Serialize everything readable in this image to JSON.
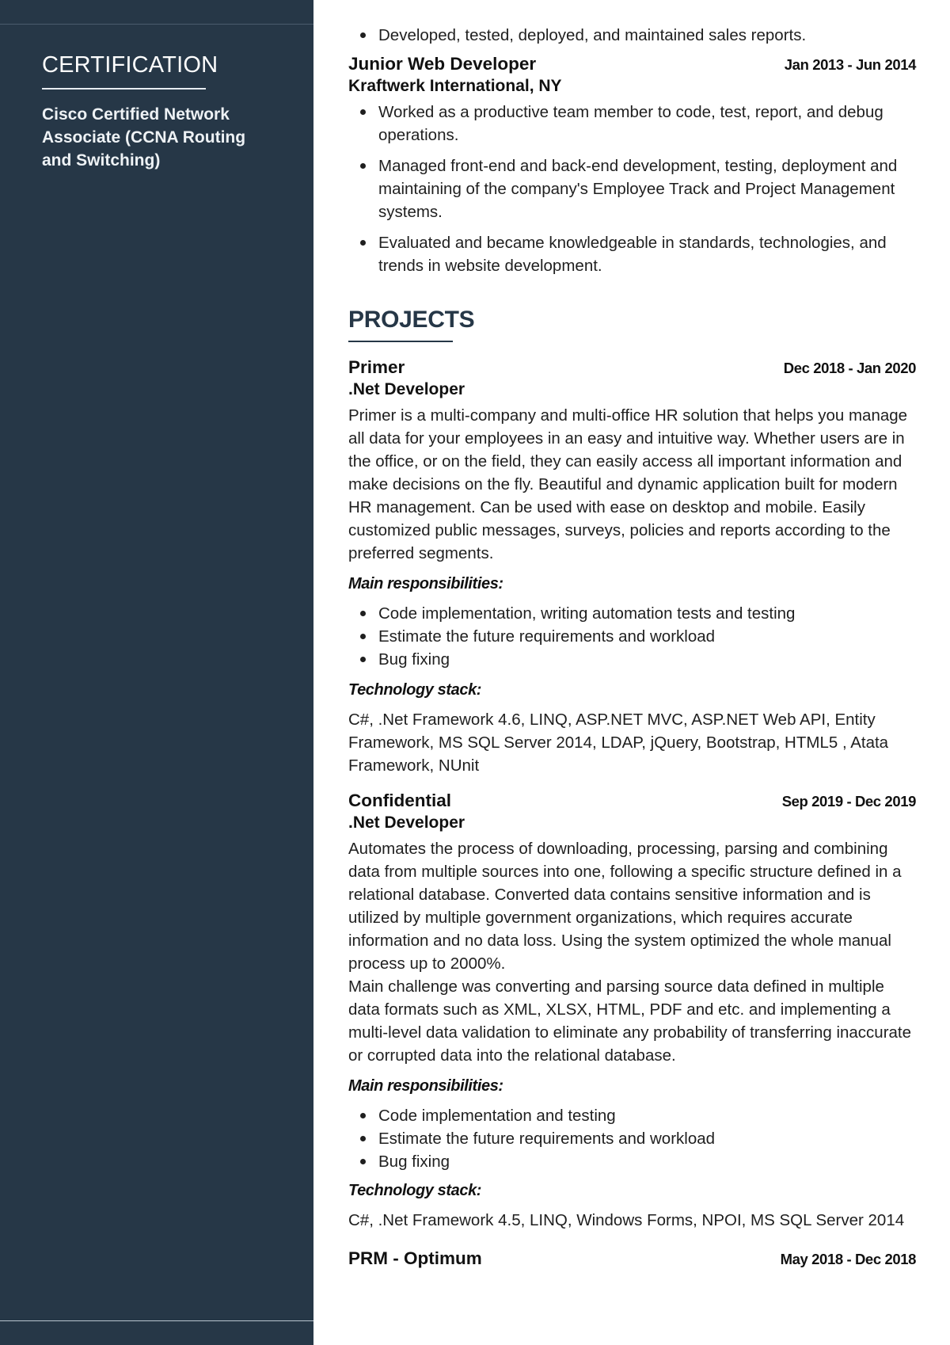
{
  "sidebar": {
    "certification_title": "CERTIFICATION",
    "certification_item": "Cisco Certified Network Associate (CCNA Routing and Switching)",
    "colors": {
      "background": "#263747",
      "text": "#ffffff"
    }
  },
  "experience_tail": {
    "previous_bullets": [
      "Developed, tested, deployed, and maintained sales reports."
    ],
    "jobs": [
      {
        "title": "Junior Web Developer",
        "dates": "Jan 2013 - Jun 2014",
        "company": "Kraftwerk International, NY",
        "bullets": [
          "Worked as a productive team member to code, test, report, and debug operations.",
          "Managed front-end and back-end development, testing, deployment and maintaining of the company's Employee Track and Project Management systems.",
          "Evaluated and became knowledgeable in standards, technologies, and trends in website development."
        ]
      }
    ]
  },
  "projects": {
    "heading": "PROJECTS",
    "accent_color": "#263747",
    "items": [
      {
        "name": "Primer",
        "dates": "Dec 2018 - Jan 2020",
        "role": ".Net Developer",
        "description": [
          "Primer is a multi-company and multi-office HR solution that helps you manage all data for your employees in an easy and intuitive way. Whether users are in the office, or on the field, they can easily access all important information and make decisions on the fly. Beautiful and dynamic application built for modern HR management. Can be used with ease on desktop and mobile. Easily customized public messages, surveys, policies and reports according to the preferred segments."
        ],
        "responsibilities_label": "Main responsibilities:",
        "responsibilities": [
          "Code implementation, writing automation tests and testing",
          "Estimate the future requirements and workload",
          "Bug fixing"
        ],
        "tech_label": "Technology stack:",
        "tech": "C#, .Net Framework 4.6, LINQ, ASP.NET MVC, ASP.NET Web API, Entity Framework, MS SQL Server 2014, LDAP, jQuery, Bootstrap, HTML5 , Atata Framework, NUnit"
      },
      {
        "name": "Confidential",
        "dates": "Sep 2019 - Dec 2019",
        "role": ".Net Developer",
        "description": [
          "Automates the process of downloading, processing, parsing and combining data from multiple sources into one, following a specific structure defined in a relational database. Converted data contains sensitive information and is utilized by multiple government organizations, which requires accurate information and no data loss. Using the system optimized the whole manual process up to 2000%.",
          "Main challenge was converting and parsing source data defined in multiple data formats such as XML, XLSX, HTML, PDF and etc. and implementing a multi-level data validation to eliminate any probability of transferring inaccurate or corrupted data into the relational database."
        ],
        "responsibilities_label": "Main responsibilities:",
        "responsibilities": [
          "Code implementation and testing",
          "Estimate the future requirements and workload",
          "Bug fixing"
        ],
        "tech_label": "Technology stack:",
        "tech": "C#, .Net Framework 4.5, LINQ, Windows Forms, NPOI, MS SQL Server 2014"
      },
      {
        "name": "PRM - Optimum",
        "dates": "May 2018 - Dec 2018"
      }
    ]
  }
}
